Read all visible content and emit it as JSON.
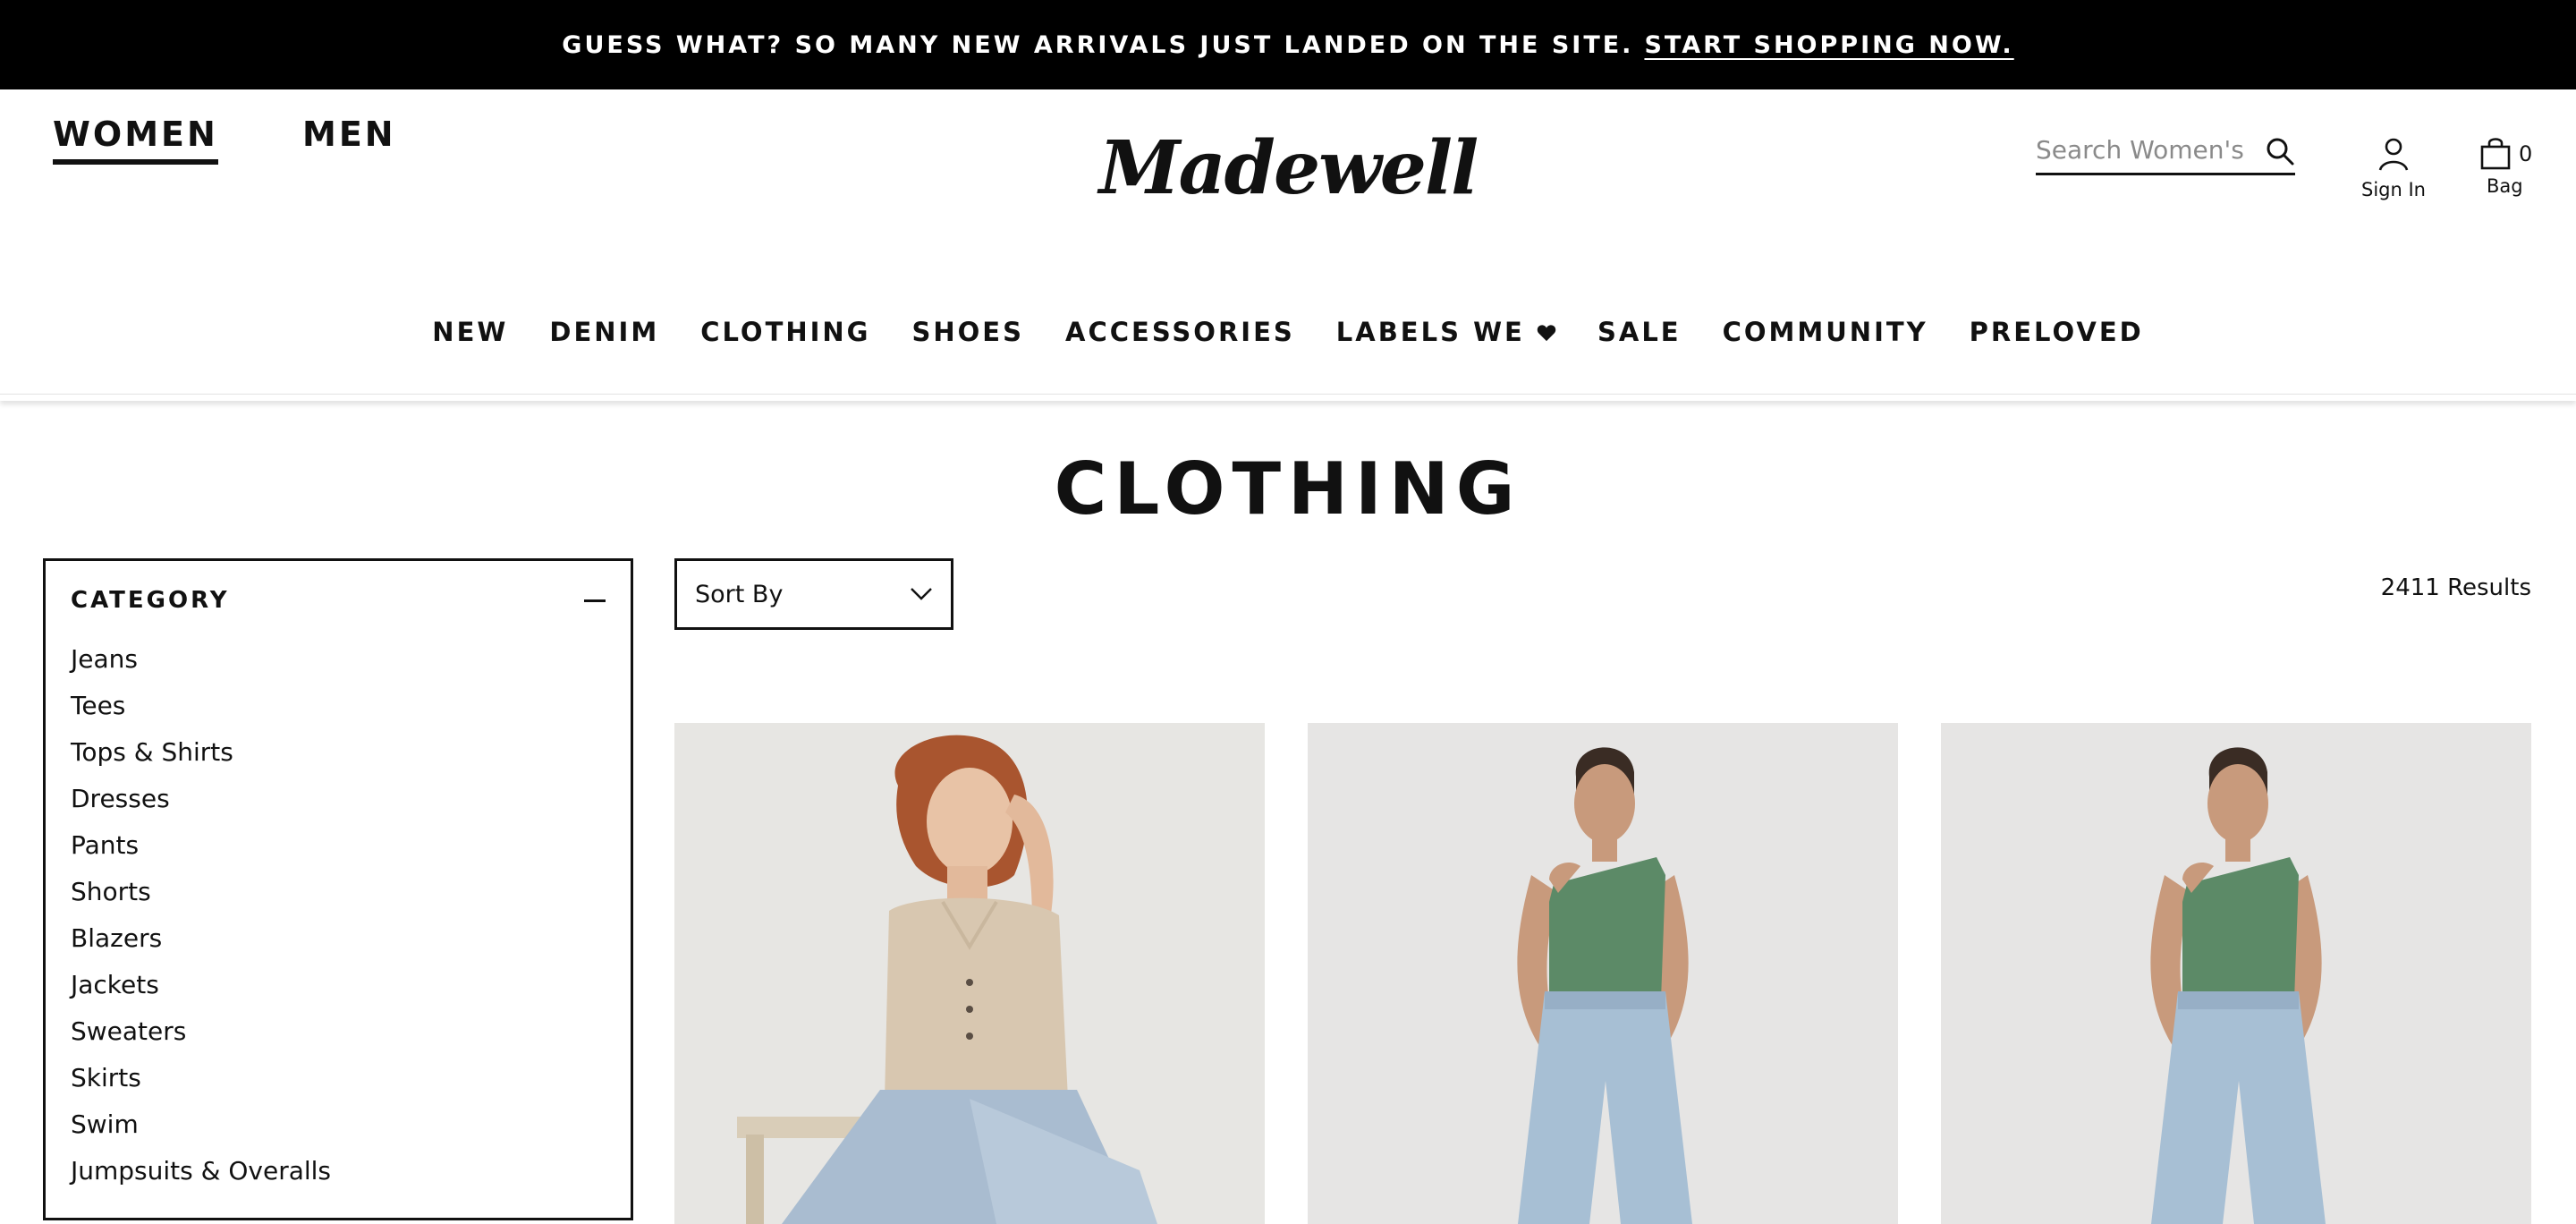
{
  "promo": {
    "message": "GUESS WHAT? SO MANY NEW ARRIVALS JUST LANDED ON THE SITE.",
    "cta": "START SHOPPING NOW."
  },
  "header": {
    "gender_tabs": [
      "WOMEN",
      "MEN"
    ],
    "active_gender": "WOMEN",
    "logo_text": "Madewell",
    "search_placeholder": "Search Women's",
    "account_label": "Sign In",
    "bag_label": "Bag",
    "bag_count": "0"
  },
  "nav": {
    "items": [
      "NEW",
      "DENIM",
      "CLOTHING",
      "SHOES",
      "ACCESSORIES",
      "LABELS WE",
      "SALE",
      "COMMUNITY",
      "PRELOVED"
    ]
  },
  "page": {
    "title": "CLOTHING",
    "results": "2411 Results"
  },
  "filter": {
    "heading": "CATEGORY",
    "items": [
      "Jeans",
      "Tees",
      "Tops & Shirts",
      "Dresses",
      "Pants",
      "Shorts",
      "Blazers",
      "Jackets",
      "Sweaters",
      "Skirts",
      "Swim",
      "Jumpsuits & Overalls"
    ]
  },
  "sort": {
    "label": "Sort By"
  },
  "products": [
    {
      "image": "model-sleeveless-knit-polo"
    },
    {
      "image": "model-one-shoulder-green-top"
    },
    {
      "image": "model-one-shoulder-green-top"
    }
  ],
  "icons": {
    "search": "search-icon",
    "account": "user-icon",
    "bag": "bag-icon",
    "heart": "heart-icon",
    "collapse": "minus-icon",
    "sort": "chevron-down-icon"
  }
}
